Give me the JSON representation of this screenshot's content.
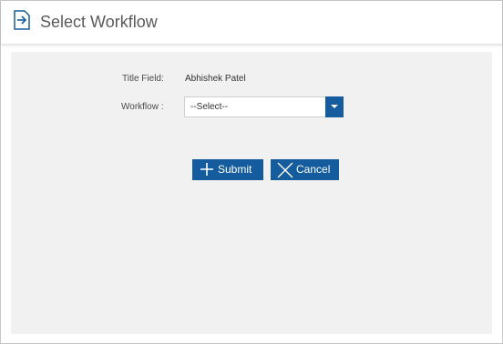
{
  "dialog": {
    "title": "Select Workflow",
    "header_icon": "arrow-right-into-box-icon"
  },
  "form": {
    "title_field_label": "Title Field:",
    "title_field_value": "Abhishek Patel",
    "workflow_label": "Workflow :",
    "workflow_selected": "--Select--"
  },
  "buttons": {
    "submit_label": "Submit",
    "submit_icon": "plus-icon",
    "cancel_label": "Cancel",
    "cancel_icon": "close-icon"
  },
  "colors": {
    "accent": "#145c9e",
    "panel_background": "#f1f1f1",
    "title_text": "#5a5a5a"
  }
}
